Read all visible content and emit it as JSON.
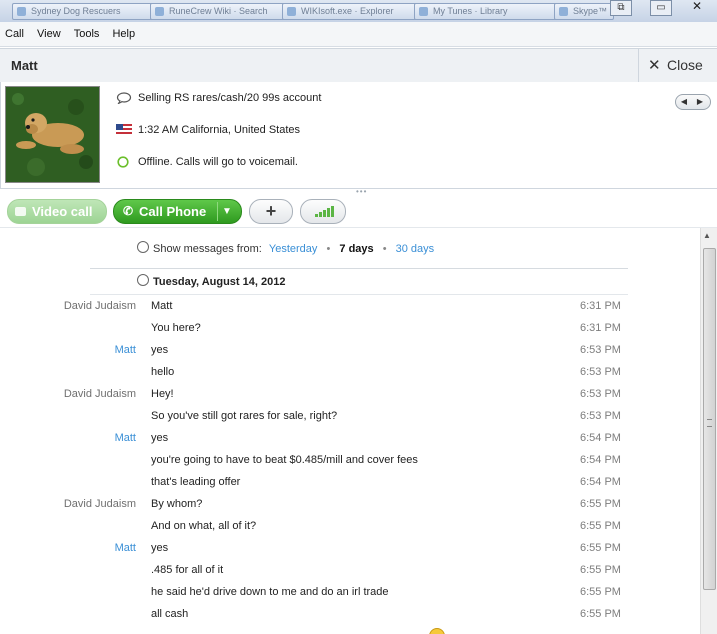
{
  "window": {
    "taskbar_items": [
      "Sydney Dog Rescuers",
      "RuneCrew Wiki · Search",
      "WIKIsoft.exe · Explorer",
      "My Tunes · Library",
      "Skype™"
    ],
    "controls": {
      "restore": "⧉",
      "minimize": "▭",
      "close": "✕"
    }
  },
  "menubar": {
    "items": [
      "Call",
      "View",
      "Tools",
      "Help"
    ]
  },
  "contact": {
    "name": "Matt",
    "close_label": "Close",
    "close_icon": "close-icon"
  },
  "profile": {
    "mood": "Selling RS rares/cash/20 99s account",
    "local_time": "1:32 AM California, United States",
    "status": "Offline. Calls will go to voicemail."
  },
  "toolbar": {
    "video_label": "Video call",
    "call_label": "Call Phone",
    "add_label": "+",
    "accent": "#3ba82b"
  },
  "chat": {
    "filter": {
      "prefix": "Show messages from:",
      "options": [
        "Yesterday",
        "7 days",
        "30 days"
      ],
      "selected": "7 days"
    },
    "date_header": "Tuesday, August 14, 2012",
    "messages": [
      {
        "sender": "David Judaism",
        "text": "Matt",
        "time": "6:31 PM"
      },
      {
        "sender": "",
        "text": "You here?",
        "time": "6:31 PM"
      },
      {
        "sender": "Matt",
        "text": "yes",
        "time": "6:53 PM"
      },
      {
        "sender": "",
        "text": "hello",
        "time": "6:53 PM"
      },
      {
        "sender": "David Judaism",
        "text": "Hey!",
        "time": "6:53 PM"
      },
      {
        "sender": "",
        "text": "So you've still got rares for sale, right?",
        "time": "6:53 PM"
      },
      {
        "sender": "Matt",
        "text": "yes",
        "time": "6:54 PM"
      },
      {
        "sender": "",
        "text": "you're going to have to beat $0.485/mill and cover fees",
        "time": "6:54 PM"
      },
      {
        "sender": "",
        "text": "that's leading offer",
        "time": "6:54 PM"
      },
      {
        "sender": "David Judaism",
        "text": "By whom?",
        "time": "6:55 PM"
      },
      {
        "sender": "",
        "text": "And on what, all of it?",
        "time": "6:55 PM"
      },
      {
        "sender": "Matt",
        "text": "yes",
        "time": "6:55 PM"
      },
      {
        "sender": "",
        "text": ".485 for all of it",
        "time": "6:55 PM"
      },
      {
        "sender": "",
        "text": "he said he'd drive down to me and do an irl trade",
        "time": "6:55 PM"
      },
      {
        "sender": "",
        "text": "all cash",
        "time": "6:55 PM"
      }
    ]
  },
  "colors": {
    "link_blue": "#3a8fd6",
    "other_sender": "#6f6f6f",
    "green_call": "#3ba82b",
    "green_video_disabled": "#a9dba0"
  }
}
